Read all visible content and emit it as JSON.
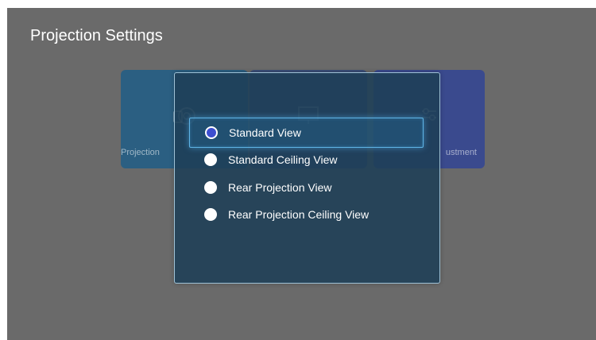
{
  "page_title": "Projection Settings",
  "cards": [
    {
      "label": "Projection",
      "icon": "projector-icon"
    },
    {
      "label": "",
      "icon": "screen-icon"
    },
    {
      "label": "ustment",
      "icon": "adjustment-icon"
    }
  ],
  "dialog": {
    "options": [
      {
        "label": "Standard View",
        "selected": true
      },
      {
        "label": "Standard Ceiling View",
        "selected": false
      },
      {
        "label": "Rear Projection View",
        "selected": false
      },
      {
        "label": "Rear Projection Ceiling View",
        "selected": false
      }
    ]
  },
  "colors": {
    "background": "#6a6a6a",
    "dialog": "#1e3f56",
    "selection_border": "#5fb4e6",
    "radio_checked": "#3d4fd0"
  }
}
